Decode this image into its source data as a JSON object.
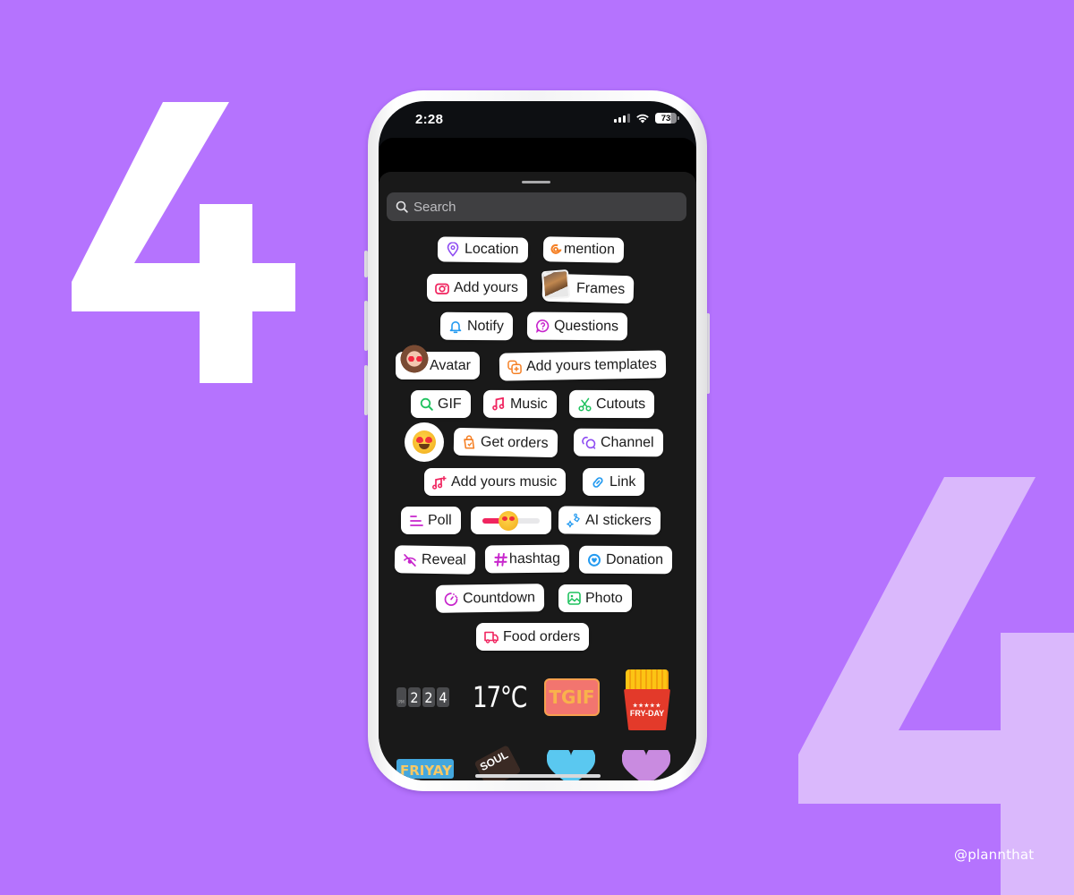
{
  "background": {
    "color": "#b573fe",
    "numeral_left": "4",
    "numeral_right": "4",
    "numeral_left_color": "#ffffff",
    "numeral_right_color": "#dab8fc",
    "watermark": "@plannthat"
  },
  "phone": {
    "status_bar": {
      "time": "2:28",
      "signal_icon": "cellular-signal-icon",
      "wifi_icon": "wifi-icon",
      "battery_level": "73"
    },
    "sheet": {
      "search": {
        "placeholder": "Search",
        "icon": "search-icon"
      },
      "stickers": [
        {
          "label": "Location",
          "icon": "location-pin-icon",
          "color": "#8e4cf2"
        },
        {
          "label": "mention",
          "icon": "threads-at-icon",
          "color": "#f58025"
        },
        {
          "label": "Add yours",
          "icon": "camera-icon",
          "color": "#f0245f"
        },
        {
          "label": "Frames",
          "icon": "photo-frame-thumbnail"
        },
        {
          "label": "Notify",
          "icon": "bell-icon",
          "color": "#259bf0"
        },
        {
          "label": "Questions",
          "icon": "question-bubble-icon",
          "color": "#c724cc"
        },
        {
          "label": "Avatar",
          "icon": "avatar-thumbnail"
        },
        {
          "label": "Add yours templates",
          "icon": "add-templates-icon",
          "color": "#f58025"
        },
        {
          "label": "GIF",
          "icon": "search-icon",
          "color": "#1fc25f"
        },
        {
          "label": "Music",
          "icon": "music-note-icon",
          "color": "#f0245f"
        },
        {
          "label": "Cutouts",
          "icon": "scissors-icon",
          "color": "#1fc25f"
        },
        {
          "label": "",
          "icon": "heart-eyes-emoji-reaction"
        },
        {
          "label": "Get orders",
          "icon": "shopping-bag-icon",
          "color": "#f58025"
        },
        {
          "label": "Channel",
          "icon": "channel-bubbles-icon",
          "color": "#8e4cf2"
        },
        {
          "label": "Add yours music",
          "icon": "music-plus-icon",
          "color": "#f0245f"
        },
        {
          "label": "Link",
          "icon": "link-icon",
          "color": "#259bf0"
        },
        {
          "label": "Poll",
          "icon": "poll-lines-icon",
          "color": "#c724cc"
        },
        {
          "label": "",
          "icon": "emoji-slider",
          "slider_value": 0.45
        },
        {
          "label": "AI stickers",
          "icon": "sparkle-stickers-icon",
          "color": "#259bf0"
        },
        {
          "label": "Reveal",
          "icon": "eye-off-icon",
          "color": "#c724cc"
        },
        {
          "label": "hashtag",
          "icon": "hashtag-icon",
          "color": "#c724cc"
        },
        {
          "label": "Donation",
          "icon": "donation-heart-icon",
          "color": "#259bf0"
        },
        {
          "label": "Countdown",
          "icon": "timer-icon",
          "color": "#c724cc"
        },
        {
          "label": "Photo",
          "icon": "image-icon",
          "color": "#1fc25f"
        },
        {
          "label": "Food orders",
          "icon": "delivery-truck-icon",
          "color": "#f0245f"
        }
      ],
      "bottom_stickers": {
        "clock": [
          "2",
          "2",
          "4"
        ],
        "clock_period": "PM",
        "temperature": "17°C",
        "tgif": "TGIF",
        "fries_text": "FRY-DAY",
        "fries_stars": "★★★★★",
        "friyay": "FRIYAY",
        "soul": "SOUL"
      }
    }
  }
}
